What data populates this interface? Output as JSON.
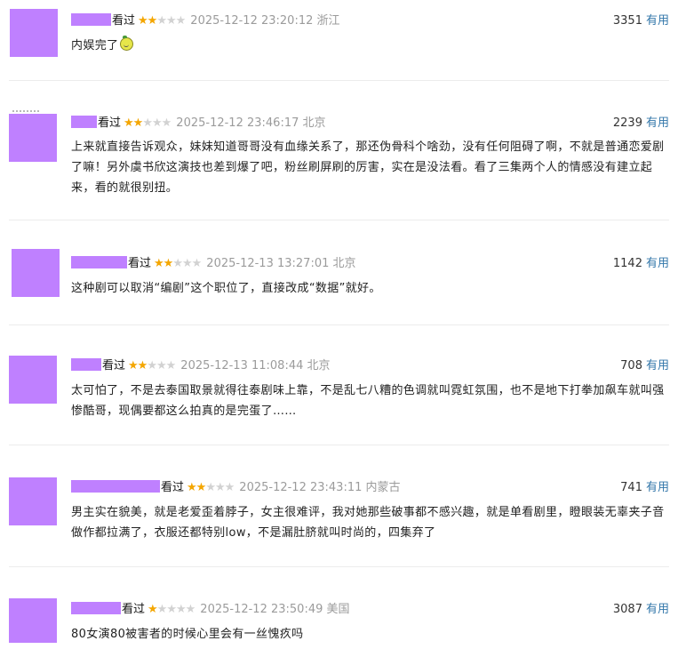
{
  "colors": {
    "avatar_placeholder": "#bf80ff",
    "star_on": "#f4a600",
    "star_off": "#d2d2d2",
    "useful_link": "#3377aa",
    "meta_gray": "#9b9b9b"
  },
  "comments": [
    {
      "seen": "看过",
      "rating": 2,
      "time": "2025-12-12 23:20:12",
      "location": "浙江",
      "votes": "3351",
      "useful": "有用",
      "text": "内娱完了",
      "emoji": "lemon-emoji"
    },
    {
      "seen": "看过",
      "rating": 2,
      "time": "2025-12-12 23:46:17",
      "location": "北京",
      "votes": "2239",
      "useful": "有用",
      "text": "上来就直接告诉观众，妹妹知道哥哥没有血缘关系了，那还伪骨科个啥劲，没有任何阻碍了啊，不就是普通恋爱剧了嘛！另外虞书欣这演技也差到爆了吧，粉丝刷屏刷的厉害，实在是没法看。看了三集两个人的情感没有建立起来，看的就很别扭。"
    },
    {
      "seen": "看过",
      "rating": 2,
      "time": "2025-12-13 13:27:01",
      "location": "北京",
      "votes": "1142",
      "useful": "有用",
      "text": "这种剧可以取消“编剧”这个职位了，直接改成“数据”就好。"
    },
    {
      "seen": "看过",
      "rating": 2,
      "time": "2025-12-13 11:08:44",
      "location": "北京",
      "votes": "708",
      "useful": "有用",
      "text": "太可怕了，不是去泰国取景就得往泰剧味上靠，不是乱七八糟的色调就叫霓虹氛围，也不是地下打拳加飙车就叫强惨酷哥，现偶要都这么拍真的是完蛋了……"
    },
    {
      "seen": "看过",
      "rating": 2,
      "time": "2025-12-12 23:43:11",
      "location": "内蒙古",
      "votes": "741",
      "useful": "有用",
      "text": "男主实在貌美，就是老爱歪着脖子，女主很难评，我对她那些破事都不感兴趣，就是单看剧里，瞪眼装无辜夹子音做作都拉满了，衣服还都特别low，不是漏肚脐就叫时尚的，四集弃了"
    },
    {
      "seen": "看过",
      "rating": 1,
      "time": "2025-12-12 23:50:49",
      "location": "美国",
      "votes": "3087",
      "useful": "有用",
      "text": "80女演80被害者的时候心里会有一丝愧疚吗"
    }
  ]
}
